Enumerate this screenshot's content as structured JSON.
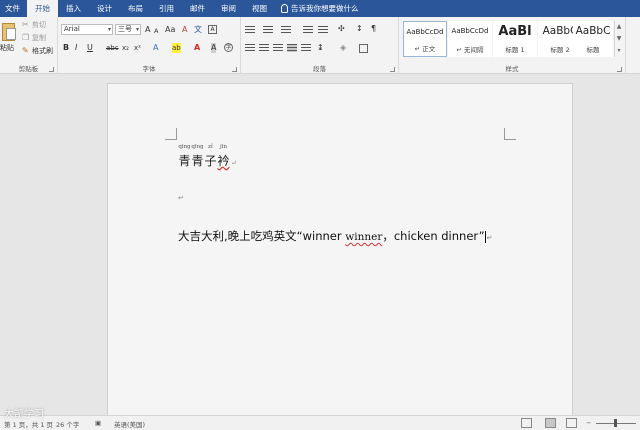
{
  "tabs": [
    "文件",
    "开始",
    "插入",
    "设计",
    "布局",
    "引用",
    "邮件",
    "审阅",
    "视图"
  ],
  "active_tab": "开始",
  "tell_me": "告诉我你想要做什么",
  "clipboard": {
    "cut": "剪切",
    "copy": "复制",
    "paste": "粘贴",
    "format_painter": "格式刷",
    "label": "剪贴板"
  },
  "font": {
    "family": "Arial",
    "size": "三号",
    "label": "字体",
    "bold": "B",
    "italic": "I",
    "underline": "U",
    "strike": "abc",
    "sub": "x₂",
    "sup": "x²",
    "grow": "A",
    "shrink": "A",
    "case": "Aa",
    "clear": "A",
    "phonetic": "文",
    "border": "A",
    "effects": "A",
    "highlight": "ab",
    "color": "A",
    "shading": "A",
    "enclose": "字"
  },
  "paragraph": {
    "label": "段落"
  },
  "styles": {
    "label": "样式",
    "items": [
      {
        "preview": "AaBbCcDd",
        "name": "↵ 正文"
      },
      {
        "preview": "AaBbCcDd",
        "name": "↵ 无间隔"
      },
      {
        "preview": "AaBl",
        "name": "标题 1"
      },
      {
        "preview": "AaBbC",
        "name": "标题 2"
      },
      {
        "preview": "AaBbC",
        "name": "标题"
      }
    ]
  },
  "document": {
    "line1": [
      {
        "char": "青",
        "pinyin": "qīng"
      },
      {
        "char": "青",
        "pinyin": "qīng"
      },
      {
        "char": "子",
        "pinyin": "zǐ"
      },
      {
        "char": "衿",
        "pinyin": "jīn"
      }
    ],
    "line3_before": "大吉大利,晚上吃鸡英文“winner ",
    "line3_wavy": "winner",
    "line3_after": "，chicken dinner”",
    "para_mark": "↵"
  },
  "status": {
    "page": "第 1 页，共 1 页",
    "words": "26 个字",
    "language": "英语(美国)"
  },
  "watermark": "大凯学习",
  "colors": {
    "ribbon_tab_bg": "#2b579a",
    "ribbon_bg": "#f3f3f3",
    "page_bg": "#f5f5f5",
    "spell_underline": "#d33"
  }
}
